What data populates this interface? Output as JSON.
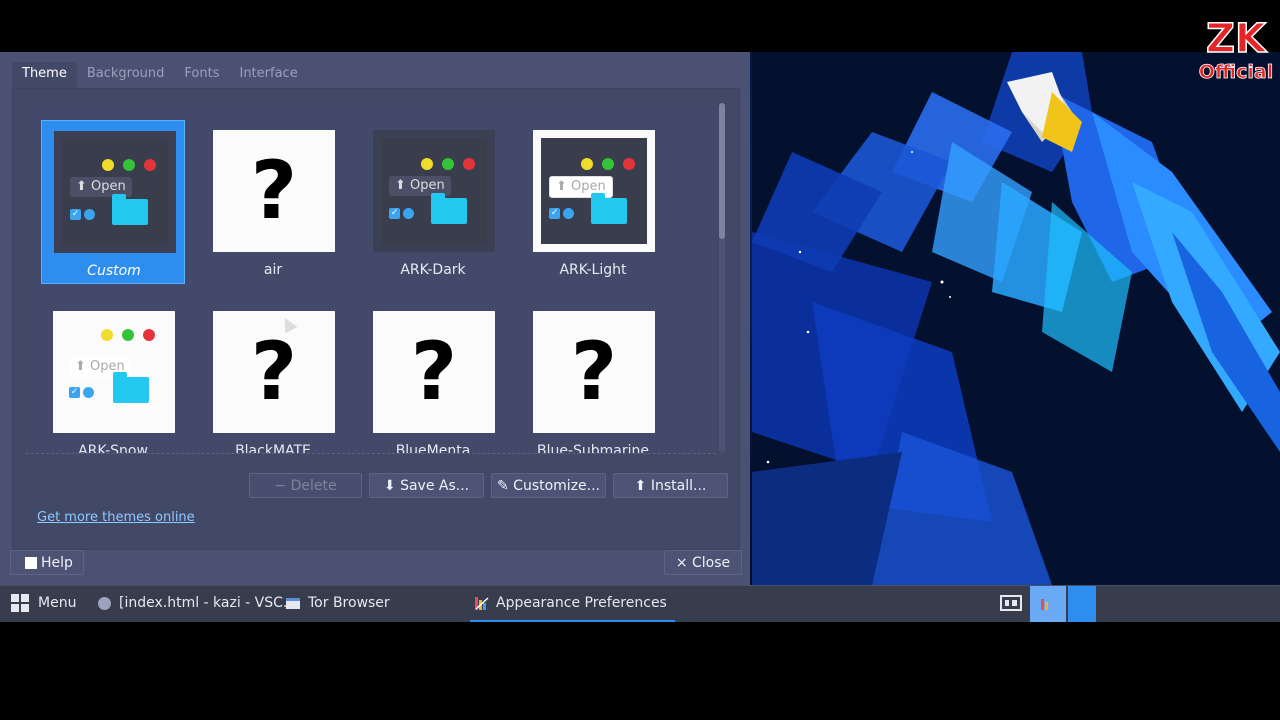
{
  "window": {
    "tabs": [
      {
        "label": "Theme",
        "active": true
      },
      {
        "label": "Background",
        "active": false
      },
      {
        "label": "Fonts",
        "active": false
      },
      {
        "label": "Interface",
        "active": false
      }
    ],
    "themes": [
      {
        "name": "Custom",
        "style": "dark",
        "selected": true
      },
      {
        "name": "air",
        "style": "unknown",
        "selected": false
      },
      {
        "name": "ARK-Dark",
        "style": "dark",
        "selected": false
      },
      {
        "name": "ARK-Light",
        "style": "card",
        "selected": false
      },
      {
        "name": "ARK-Snow",
        "style": "light",
        "selected": false
      },
      {
        "name": "BlackMATE",
        "style": "unknown",
        "selected": false
      },
      {
        "name": "BlueMenta",
        "style": "unknown",
        "selected": false
      },
      {
        "name": "Blue-Submarine",
        "style": "unknown",
        "selected": false
      }
    ],
    "thumb_open_label": "Open",
    "unknown_mark": "?",
    "buttons": {
      "delete": "− Delete",
      "save_as": "Save As...",
      "customize": "Customize...",
      "install": "Install..."
    },
    "more_link": "Get more themes online",
    "help": "Help",
    "close": "Close",
    "close_icon": "×"
  },
  "taskbar": {
    "menu": "Menu",
    "items": [
      {
        "label": "[index.html - kazi - VSC...",
        "icon": "vscode-icon"
      },
      {
        "label": "Tor Browser",
        "icon": "window-icon"
      },
      {
        "label": "Appearance Preferences",
        "icon": "appearance-icon",
        "active": true
      }
    ]
  },
  "watermark": {
    "line1": "ZK",
    "line2": "Official"
  },
  "colors": {
    "accent": "#2d8ef0",
    "window_bg": "#4a5172",
    "panel_bg": "#424967",
    "taskbar": "#383d4e"
  }
}
